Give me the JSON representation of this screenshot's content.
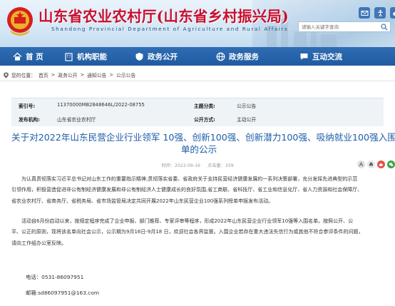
{
  "header": {
    "title_cn": "山东省农业农村厅(山东省乡村振兴局)",
    "title_en": "Shandong Provincial Department of Agriculture and Rural Affairs",
    "search_placeholder": "请输入关键字查询"
  },
  "nav": {
    "items": [
      {
        "label": "首 页",
        "icon": "home-icon"
      },
      {
        "label": "机构职能",
        "icon": "building-icon"
      },
      {
        "label": "政务公开",
        "icon": "shield-icon"
      },
      {
        "label": "政务服务",
        "icon": "globe-icon"
      },
      {
        "label": "互动交流",
        "icon": "chat-icon"
      }
    ]
  },
  "breadcrumb": {
    "prefix": "您的位置：",
    "items": [
      "首页",
      "政务公开",
      "通知公告",
      "公示公告"
    ],
    "separator": ">"
  },
  "info": {
    "index_label": "索引号:",
    "index_value": "11370000MB2848646L/2022-08755",
    "category_label": "主题分类:",
    "category_value": "公示公告",
    "org_label": "发布机构:",
    "org_value": "山东省农业农村厅",
    "method_label": "公开方式:",
    "method_value": "主动公开"
  },
  "article": {
    "title_line1": "关于对2022年山东民营企业行业领军 10强、创新100强、创新潜力100强、吸纳就业100强入围名",
    "title_line2": "单的公示",
    "date": "时间：2022-09-16",
    "views_label": "点击量：",
    "views": "339",
    "para1_line1": "为认真贯彻落实习近平总书记对山东工作的重要指示精神,贯彻落实省委、省政府关于支持民营经济健康发展的一系列决策部署，充分发挥先进典型的示范",
    "para1_line2": "引领作用，积极营造促进非公有制经济健康发展和非公有制经济人士健康成长的良好氛围,省工商联、省科技厅、省工业和信息化厅、省人力资源和社会保障厅、",
    "para1_line3": "省农业农村厅、省商务厅、省税务局、省市场监管局决定共同开展2022年山东民营企业100强系列榜单申报发布活动。",
    "para2_line1": "活动自6月份启动以来，按规定程序完成了企业申报、部门推荐、专家评审等程序，形成2022年山东民营企业行业领军10强等入围名单。按照公开、公",
    "para2_line2": "平、公正的原则，现将该名单向社会公示，公示期为9月16日-9月18 日，欢迎社会各界监督。入围企业若存在重大违法失信行为或其他不符合参评条件的问题，",
    "para2_line3": "请向工作组办公室反映。",
    "phone": "电话：0531-86097951",
    "email": "邮箱:sd86097951@163.com"
  },
  "colors": {
    "title_red": "#c8102e",
    "nav_blue": "#1f5aa0",
    "headline_blue": "#1d5ea8"
  }
}
